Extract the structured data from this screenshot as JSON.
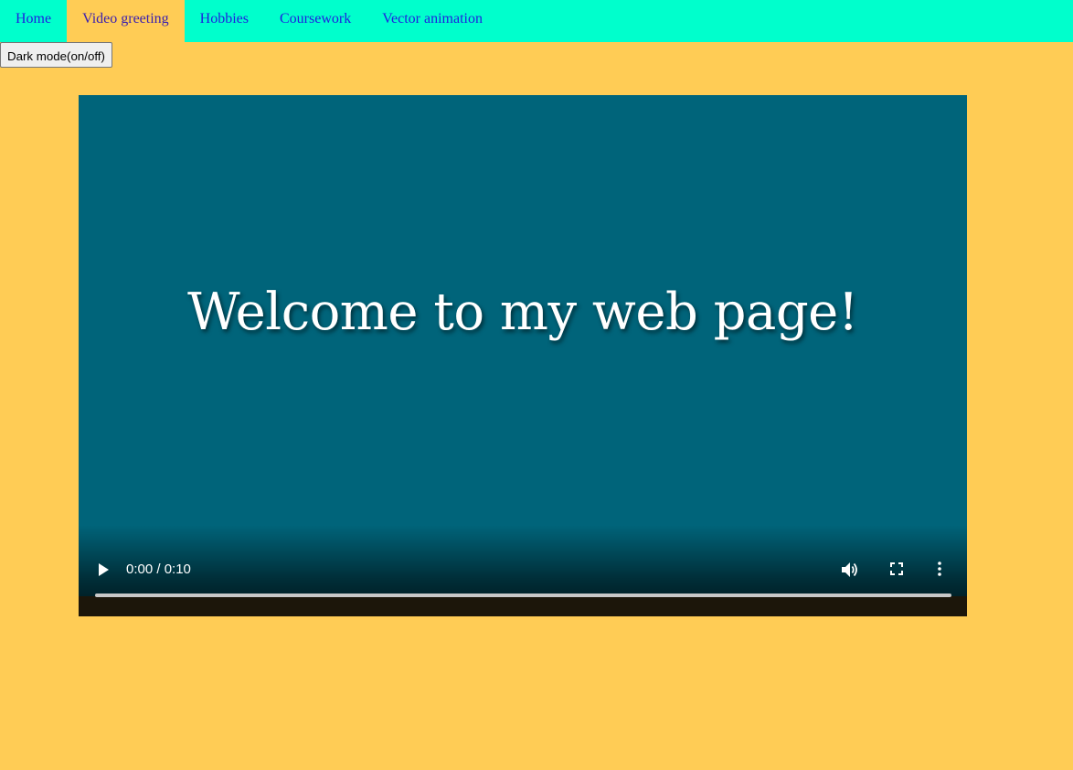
{
  "nav": {
    "items": [
      {
        "label": "Home",
        "active": false
      },
      {
        "label": "Video greeting",
        "active": true
      },
      {
        "label": "Hobbies",
        "active": false
      },
      {
        "label": "Coursework",
        "active": false
      },
      {
        "label": "Vector animation",
        "active": false
      }
    ]
  },
  "dark_mode_button": {
    "label": "Dark mode(on/off)"
  },
  "video": {
    "title": "Welcome to my web page!",
    "time": "0:00 / 0:10",
    "progress": 0.0,
    "icons": {
      "play": "play-icon",
      "volume": "volume-icon",
      "fullscreen": "fullscreen-icon",
      "more": "more-options-icon"
    }
  },
  "colors": {
    "page_background": "#ffcc55",
    "nav_background": "#00ffcc",
    "nav_link": "#1f1fe0",
    "video_background": "#00647a"
  }
}
